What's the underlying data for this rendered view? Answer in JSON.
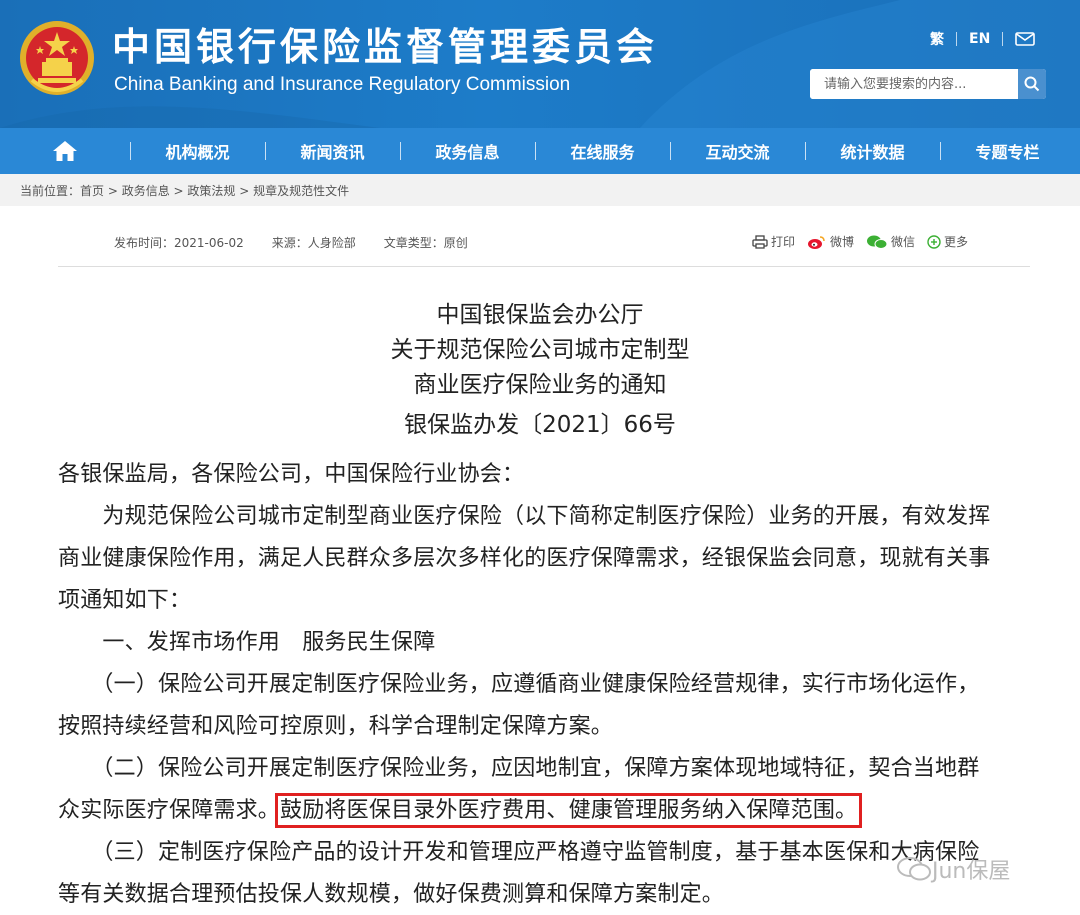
{
  "header": {
    "title_cn": "中国银行保险监督管理委员会",
    "title_en": "China Banking and Insurance Regulatory Commission",
    "lang_trad": "繁",
    "lang_en": "EN",
    "search_placeholder": "请输入您要搜索的内容..."
  },
  "nav": {
    "items": [
      "机构概况",
      "新闻资讯",
      "政务信息",
      "在线服务",
      "互动交流",
      "统计数据",
      "专题专栏"
    ]
  },
  "breadcrumb": {
    "prefix": "当前位置：",
    "items": [
      "首页",
      "政务信息",
      "政策法规",
      "规章及规范性文件"
    ],
    "sep": " > "
  },
  "meta": {
    "publish": "发布时间：2021-06-02",
    "source": "来源：人身险部",
    "type": "文章类型：原创"
  },
  "share": {
    "print": "打印",
    "weibo": "微博",
    "wechat": "微信",
    "more": "更多"
  },
  "doc": {
    "title_lines": [
      "中国银保监会办公厅",
      "关于规范保险公司城市定制型",
      "商业医疗保险业务的通知"
    ],
    "number": "银保监办发〔2021〕66号",
    "salutation": "各银保监局，各保险公司，中国保险行业协会：",
    "para1": [
      "　　为规范保险公司城市定制型商业医疗保险（以下简称定制医疗保险）业务的开展，有效发挥",
      "商业健康保险作用，满足人民群众多层次多样化的医疗保障需求，经银保监会同意，现就有关事",
      "项通知如下："
    ],
    "section1": "　　一、发挥市场作用　服务民生保障",
    "item1": [
      "　　（一）保险公司开展定制医疗保险业务，应遵循商业健康保险经营规律，实行市场化运作，",
      "按照持续经营和风险可控原则，科学合理制定保障方案。"
    ],
    "item2_line1": "　　（二）保险公司开展定制医疗保险业务，应因地制宜，保障方案体现地域特征，契合当地群",
    "item2_line2_plain": "众实际医疗保障需求。",
    "item2_line2_highlight": "鼓励将医保目录外医疗费用、健康管理服务纳入保障范围。",
    "item3": [
      "　　（三）定制医疗保险产品的设计开发和管理应严格遵守监管制度，基于基本医保和大病保险",
      "等有关数据合理预估投保人数规模，做好保费测算和保障方案制定。"
    ]
  },
  "watermark": "Jun保屋",
  "colors": {
    "header_bg": "#1d7cc9",
    "nav_bg": "#2a88d6",
    "highlight_border": "#e02020"
  }
}
